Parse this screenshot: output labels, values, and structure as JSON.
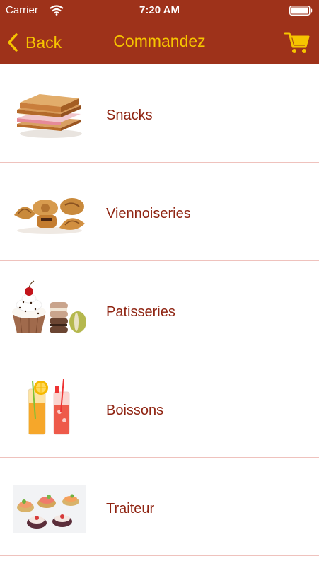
{
  "status_bar": {
    "carrier": "Carrier",
    "time": "7:20 AM",
    "wifi_icon": "wifi-icon",
    "battery_icon": "battery-icon"
  },
  "nav": {
    "back_label": "Back",
    "title": "Commandez",
    "cart_icon": "cart-icon"
  },
  "colors": {
    "bar": "#9e321a",
    "accent": "#f6c400",
    "label": "#8f2412",
    "separator": "#efc2bd"
  },
  "menu": {
    "items": [
      {
        "label": "Snacks",
        "icon": "sandwich-image"
      },
      {
        "label": "Viennoiseries",
        "icon": "pastries-image"
      },
      {
        "label": "Patisseries",
        "icon": "cupcake-macarons-image"
      },
      {
        "label": "Boissons",
        "icon": "drinks-image"
      },
      {
        "label": "Traiteur",
        "icon": "canapes-image"
      }
    ]
  }
}
